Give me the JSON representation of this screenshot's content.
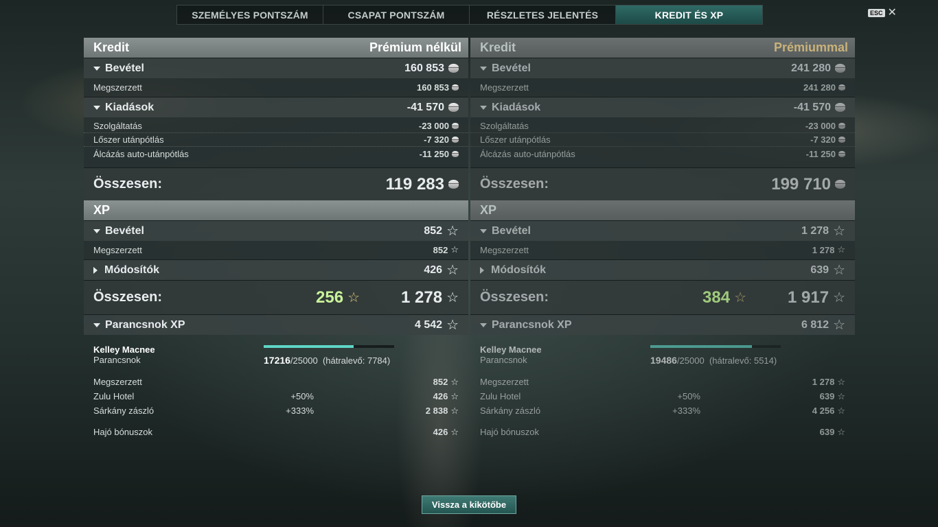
{
  "tabs": [
    "SZEMÉLYES PONTSZÁM",
    "CSAPAT PONTSZÁM",
    "RÉSZLETES JELENTÉS",
    "KREDIT ÉS XP"
  ],
  "esc": {
    "key": "ESC",
    "close": "✕"
  },
  "left": {
    "credit_title": "Kredit",
    "mode": "Prémium nélkül",
    "income": {
      "label": "Bevétel",
      "value": "160 853",
      "earned_label": "Megszerzett",
      "earned": "160 853"
    },
    "expenses": {
      "label": "Kiadások",
      "value": "-41 570",
      "items": [
        {
          "label": "Szolgáltatás",
          "value": "-23 000"
        },
        {
          "label": "Lőszer utánpótlás",
          "value": "-7 320"
        },
        {
          "label": "Álcázás auto-utánpótlás",
          "value": "-11 250"
        }
      ]
    },
    "credit_total_label": "Összesen:",
    "credit_total": "119 283",
    "xp_title": "XP",
    "xp_income": {
      "label": "Bevétel",
      "value": "852",
      "earned_label": "Megszerzett",
      "earned": "852"
    },
    "modifiers": {
      "label": "Módosítók",
      "value": "426"
    },
    "xp_total_label": "Összesen:",
    "xp_free": "256",
    "xp_total": "1 278",
    "commander_xp": {
      "label": "Parancsnok XP",
      "value": "4 542"
    },
    "commander": {
      "name": "Kelley Macnee",
      "role": "Parancsnok",
      "current": "17216",
      "max": "/25000",
      "remaining": "(hátralevő: 7784)",
      "progress": 0.69
    },
    "cmd_rows": [
      {
        "label": "Megszerzett",
        "pct": "",
        "value": "852"
      },
      {
        "label": "Zulu Hotel",
        "pct": "+50%",
        "value": "426"
      },
      {
        "label": "Sárkány zászló",
        "pct": "+333%",
        "value": "2 838"
      }
    ],
    "ship_bonus": {
      "label": "Hajó bónuszok",
      "value": "426"
    }
  },
  "right": {
    "credit_title": "Kredit",
    "mode": "Prémiummal",
    "income": {
      "label": "Bevétel",
      "value": "241 280",
      "earned_label": "Megszerzett",
      "earned": "241 280"
    },
    "expenses": {
      "label": "Kiadások",
      "value": "-41 570",
      "items": [
        {
          "label": "Szolgáltatás",
          "value": "-23 000"
        },
        {
          "label": "Lőszer utánpótlás",
          "value": "-7 320"
        },
        {
          "label": "Álcázás auto-utánpótlás",
          "value": "-11 250"
        }
      ]
    },
    "credit_total_label": "Összesen:",
    "credit_total": "199 710",
    "xp_title": "XP",
    "xp_income": {
      "label": "Bevétel",
      "value": "1 278",
      "earned_label": "Megszerzett",
      "earned": "1 278"
    },
    "modifiers": {
      "label": "Módosítók",
      "value": "639"
    },
    "xp_total_label": "Összesen:",
    "xp_free": "384",
    "xp_total": "1 917",
    "commander_xp": {
      "label": "Parancsnok XP",
      "value": "6 812"
    },
    "commander": {
      "name": "Kelley Macnee",
      "role": "Parancsnok",
      "current": "19486",
      "max": "/25000",
      "remaining": "(hátralevő: 5514)",
      "progress": 0.78
    },
    "cmd_rows": [
      {
        "label": "Megszerzett",
        "pct": "",
        "value": "1 278"
      },
      {
        "label": "Zulu Hotel",
        "pct": "+50%",
        "value": "639"
      },
      {
        "label": "Sárkány zászló",
        "pct": "+333%",
        "value": "4 256"
      }
    ],
    "ship_bonus": {
      "label": "Hajó bónuszok",
      "value": "639"
    }
  },
  "back_button": "Vissza a kikötőbe"
}
